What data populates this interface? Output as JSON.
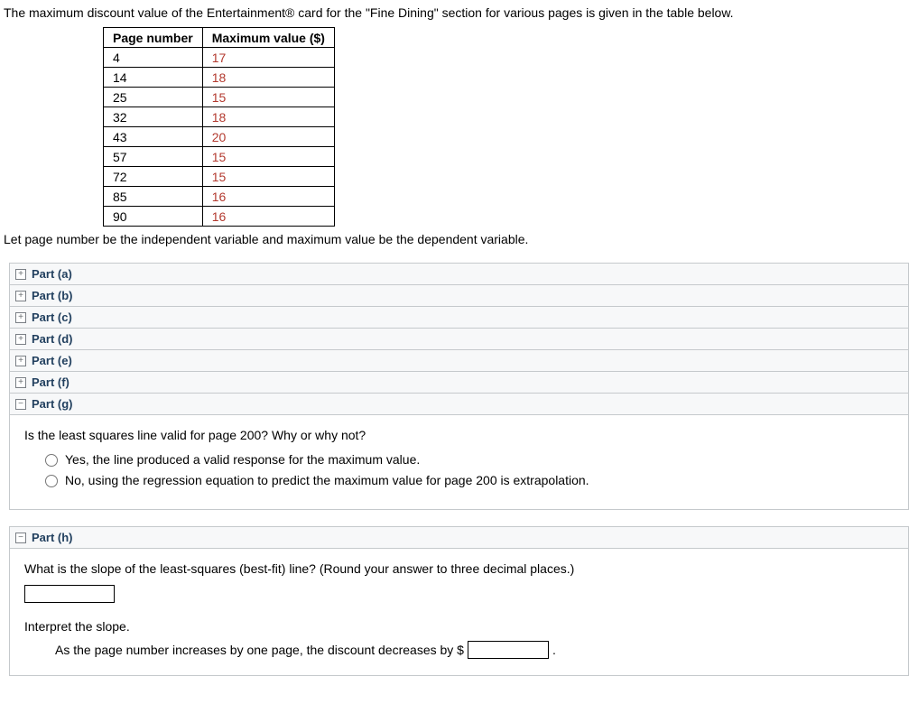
{
  "intro": "The maximum discount value of the Entertainment® card for the \"Fine Dining\" section for various pages is given in the table below.",
  "table": {
    "headers": [
      "Page number",
      "Maximum value ($)"
    ],
    "rows": [
      {
        "page": "4",
        "value": "17"
      },
      {
        "page": "14",
        "value": "18"
      },
      {
        "page": "25",
        "value": "15"
      },
      {
        "page": "32",
        "value": "18"
      },
      {
        "page": "43",
        "value": "20"
      },
      {
        "page": "57",
        "value": "15"
      },
      {
        "page": "72",
        "value": "15"
      },
      {
        "page": "85",
        "value": "16"
      },
      {
        "page": "90",
        "value": "16"
      }
    ]
  },
  "after_table": "Let page number be the independent variable and maximum value be the dependent variable.",
  "icons": {
    "plus": "+",
    "minus": "−"
  },
  "parts": {
    "a": "Part (a)",
    "b": "Part (b)",
    "c": "Part (c)",
    "d": "Part (d)",
    "e": "Part (e)",
    "f": "Part (f)",
    "g": "Part (g)",
    "h": "Part (h)"
  },
  "part_g": {
    "question": "Is the least squares line valid for page 200? Why or why not?",
    "option_yes": "Yes, the line produced a valid response for the maximum value.",
    "option_no": "No, using the regression equation to predict the maximum value for page 200 is extrapolation."
  },
  "part_h": {
    "question": "What is the slope of the least-squares (best-fit) line? (Round your answer to three decimal places.)",
    "slope_value": "",
    "interpret_heading": "Interpret the slope.",
    "interpret_sentence_a": "As the page number increases by one page, the discount decreases by $",
    "interpret_value": "",
    "interpret_sentence_b": "."
  }
}
